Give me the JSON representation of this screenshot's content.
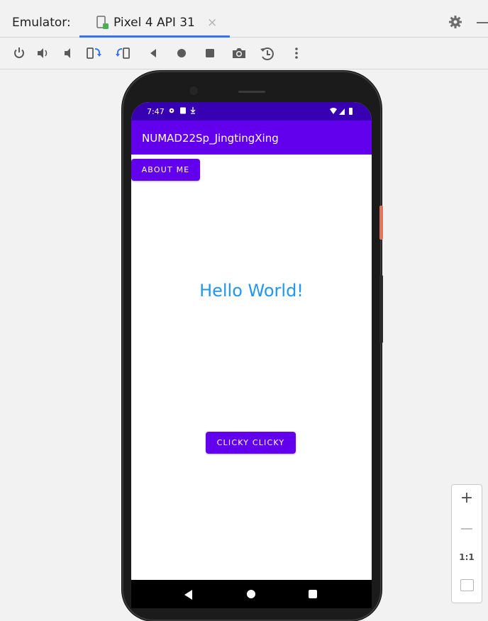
{
  "emulator": {
    "label": "Emulator:",
    "tab_title": "Pixel 4 API 31",
    "tab_close": "×"
  },
  "toolbar": {
    "buttons": [
      "power-icon",
      "volume-up-icon",
      "volume-down-icon",
      "rotate-left-icon",
      "rotate-right-icon",
      "back-icon",
      "home-icon",
      "overview-icon",
      "screenshot-icon",
      "snapshot-icon",
      "more-icon"
    ]
  },
  "device": {
    "status_time": "7:47",
    "app_title": "NUMAD22Sp_JingtingXing",
    "about_button": "ABOUT ME",
    "hello_text": "Hello World!",
    "clicky_button": "CLICKY CLICKY"
  },
  "zoom": {
    "plus": "+",
    "one_to_one": "1:1"
  },
  "colors": {
    "accent_tab": "#3574f0",
    "status_bar": "#3700b3",
    "app_bar": "#6200ee",
    "hello_text": "#2196f3"
  }
}
